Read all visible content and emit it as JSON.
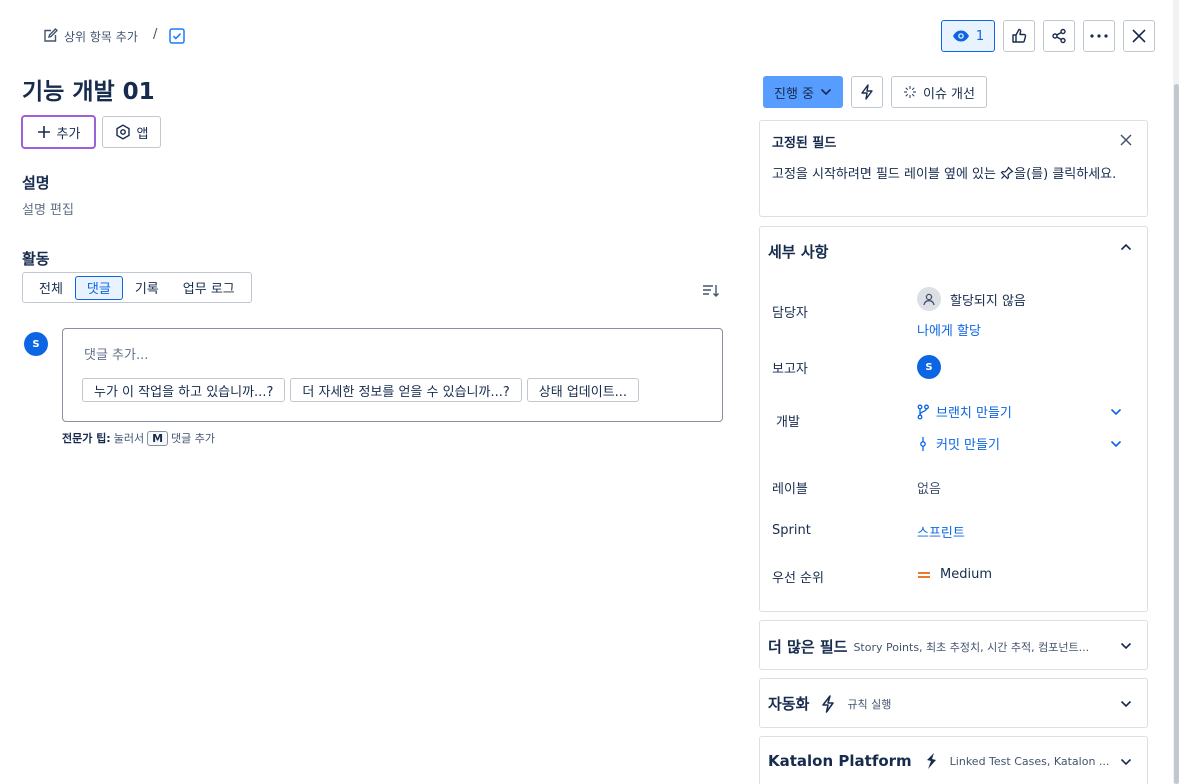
{
  "breadcrumb": {
    "add_parent_label": "상위 항목 추가",
    "separator": "/"
  },
  "toolbar": {
    "watch_count": "1"
  },
  "issue": {
    "title": "기능 개발 01"
  },
  "actions": {
    "add_label": "추가",
    "app_label": "앱"
  },
  "description": {
    "heading": "설명",
    "edit_label": "설명 편집"
  },
  "activity": {
    "heading": "활동",
    "tabs": [
      {
        "label": "전체"
      },
      {
        "label": "댓글"
      },
      {
        "label": "기록"
      },
      {
        "label": "업무 로그"
      }
    ],
    "active_tab": "댓글"
  },
  "comment": {
    "avatar_initial": "S",
    "placeholder": "댓글 추가...",
    "suggestions": [
      {
        "label": "누가 이 작업을 하고 있습니까...?"
      },
      {
        "label": "더 자세한 정보를 얻을 수 있습니까...?"
      },
      {
        "label": "상태 업데이트..."
      }
    ],
    "tip_bold": "전문가 팁:",
    "tip_press": "눌러서",
    "tip_key": "M",
    "tip_action": "댓글 추가"
  },
  "status": {
    "label": "진행 중",
    "improve_label": "이슈 개선"
  },
  "pinned": {
    "title": "고정된 필드",
    "text_before": "고정을 시작하려면 필드 레이블 옆에 있는",
    "text_after": "을(를) 클릭하세요."
  },
  "details": {
    "title": "세부 사항",
    "assignee_label": "담당자",
    "assignee_value": "할당되지 않음",
    "assign_to_me": "나에게 할당",
    "reporter_label": "보고자",
    "reporter_initial": "S",
    "dev_label": "개발",
    "create_branch": "브랜치 만들기",
    "create_commit": "커밋 만들기",
    "labels_label": "레이블",
    "labels_value": "없음",
    "sprint_label": "Sprint",
    "sprint_value": "스프린트",
    "priority_label": "우선 순위",
    "priority_value": "Medium"
  },
  "more_fields": {
    "title": "더 많은 필드",
    "subtitle": "Story Points, 최초 추정치, 시간 추적, 컴포넌트..."
  },
  "automation": {
    "title": "자동화",
    "subtitle": "규칙 실행"
  },
  "katalon": {
    "title": "Katalon Platform",
    "subtitle": "Linked Test Cases, Katalon ..."
  },
  "colors": {
    "accent": "#0c66e4",
    "status_bg": "#579dff",
    "priority_medium": "#e56910",
    "add_button_border": "#9f5fd6"
  }
}
